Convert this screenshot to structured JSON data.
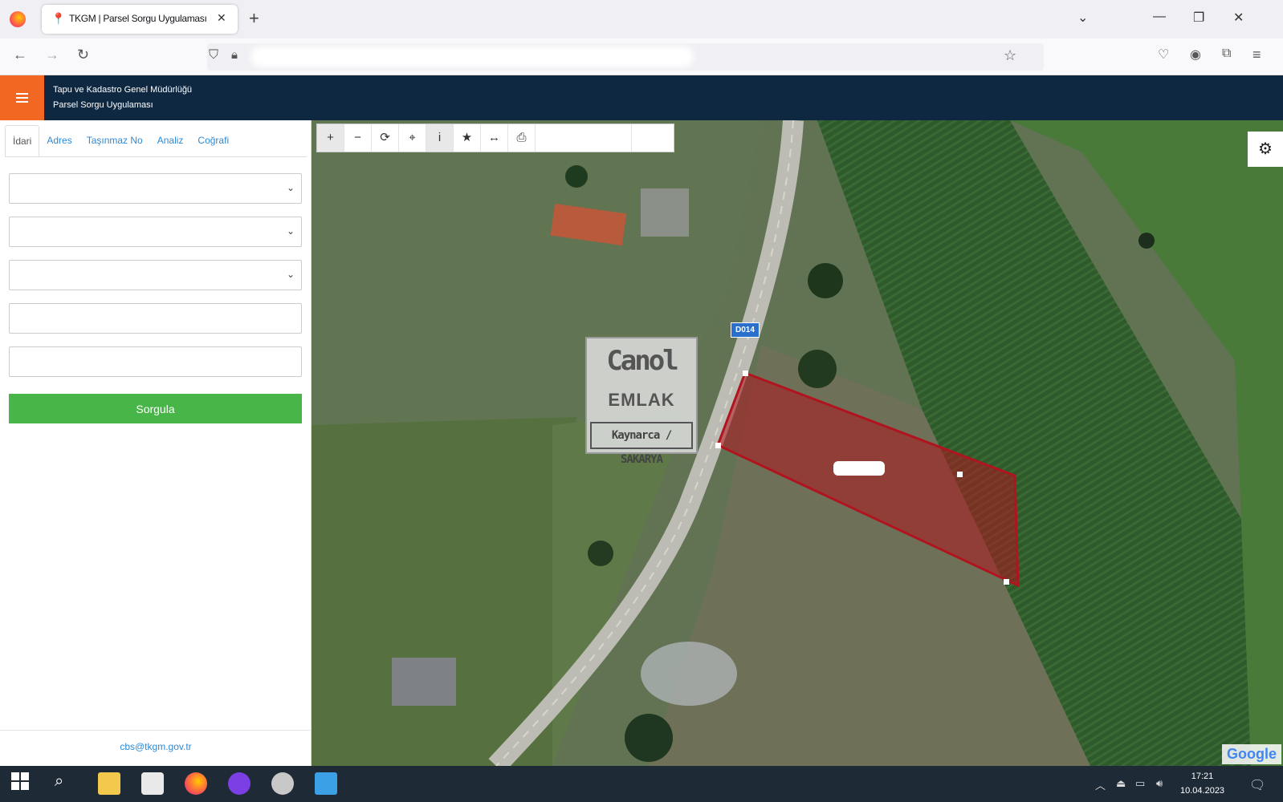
{
  "browser": {
    "tab_title": "TKGM | Parsel Sorgu Uygulaması",
    "tab_close": "✕",
    "new_tab": "+"
  },
  "app": {
    "title_line1": "Tapu ve Kadastro Genel Müdürlüğü",
    "title_line2": "Parsel Sorgu Uygulaması"
  },
  "sidebar": {
    "tabs": [
      "İdari",
      "Adres",
      "Taşınmaz No",
      "Analiz",
      "Coğrafi"
    ],
    "active_tab": "İdari",
    "fields": [
      {
        "type": "select",
        "value": ""
      },
      {
        "type": "select",
        "value": ""
      },
      {
        "type": "select",
        "value": ""
      },
      {
        "type": "text",
        "value": ""
      },
      {
        "type": "text",
        "value": ""
      }
    ],
    "query_button": "Sorgula",
    "contact_email": "cbs@tkgm.gov.tr"
  },
  "map": {
    "toolbar_icons": [
      "zoom-in-icon",
      "zoom-out-icon",
      "refresh-icon",
      "locate-icon",
      "info-icon",
      "bookmark-star-icon",
      "measure-icon",
      "print-icon"
    ],
    "road_label": "D014",
    "watermark": {
      "logo": "Canol",
      "sub": "EMLAK",
      "place": "Kaynarca / SAKARYA"
    },
    "attribution": "Google",
    "parcel_color": "#b0141f"
  },
  "taskbar": {
    "time": "17:21",
    "date": "10.04.2023"
  }
}
